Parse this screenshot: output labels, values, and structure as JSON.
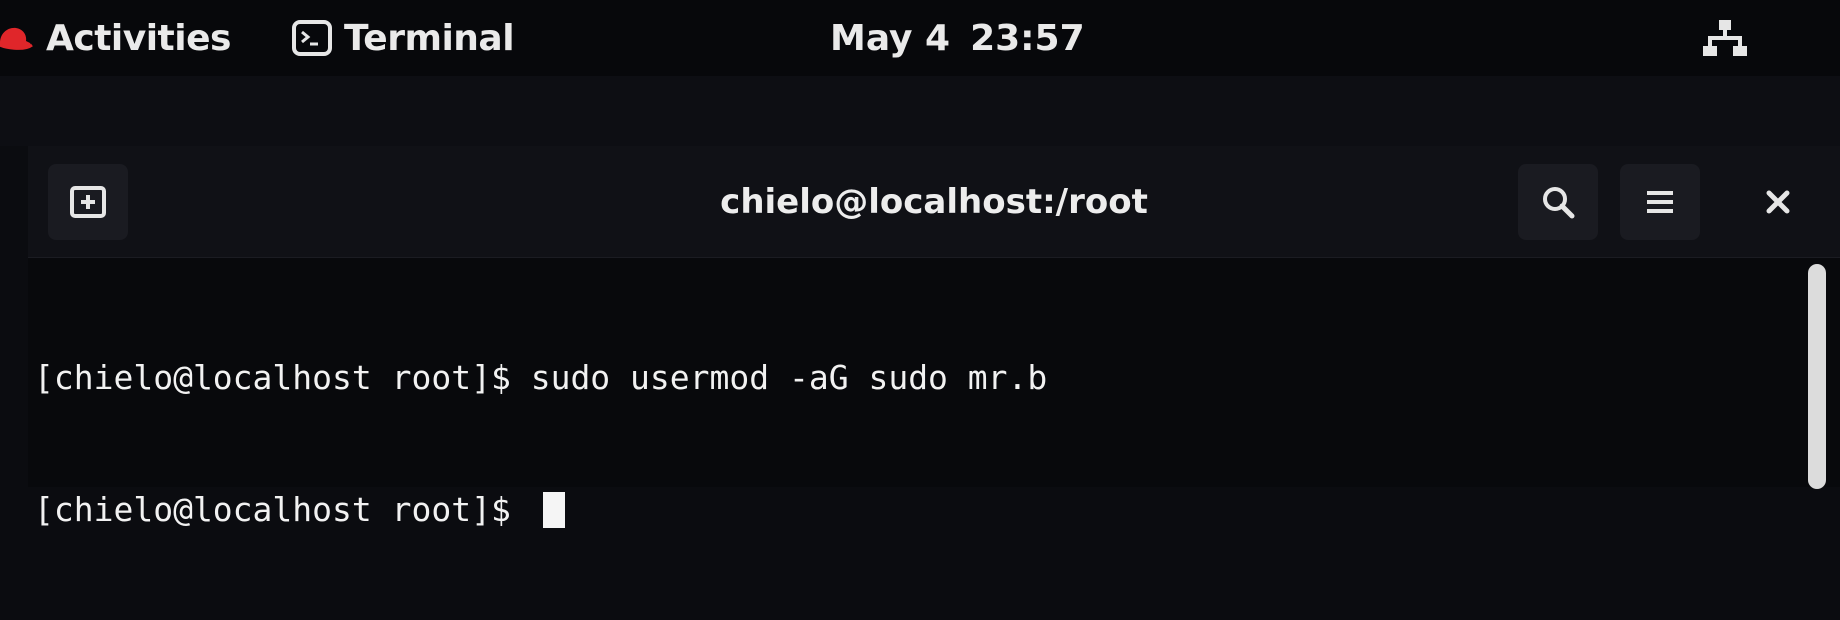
{
  "topbar": {
    "activities_label": "Activities",
    "app_label": "Terminal",
    "date": "May 4",
    "time": "23:57",
    "icons": {
      "brand": "redhat-icon",
      "app": "terminal-app-icon",
      "status": "network-icon"
    }
  },
  "window": {
    "title": "chielo@localhost:/root",
    "buttons": {
      "new_tab": "new-tab-icon",
      "search": "search-icon",
      "menu": "hamburger-menu-icon",
      "close": "close-icon"
    }
  },
  "terminal": {
    "lines": [
      {
        "prompt": "[chielo@localhost root]$ ",
        "command": "sudo usermod -aG sudo mr.b"
      },
      {
        "prompt": "[chielo@localhost root]$ ",
        "command": ""
      }
    ]
  },
  "colors": {
    "accent_red": "#e0262a",
    "background": "#08090c",
    "text": "#f2f2f2"
  }
}
